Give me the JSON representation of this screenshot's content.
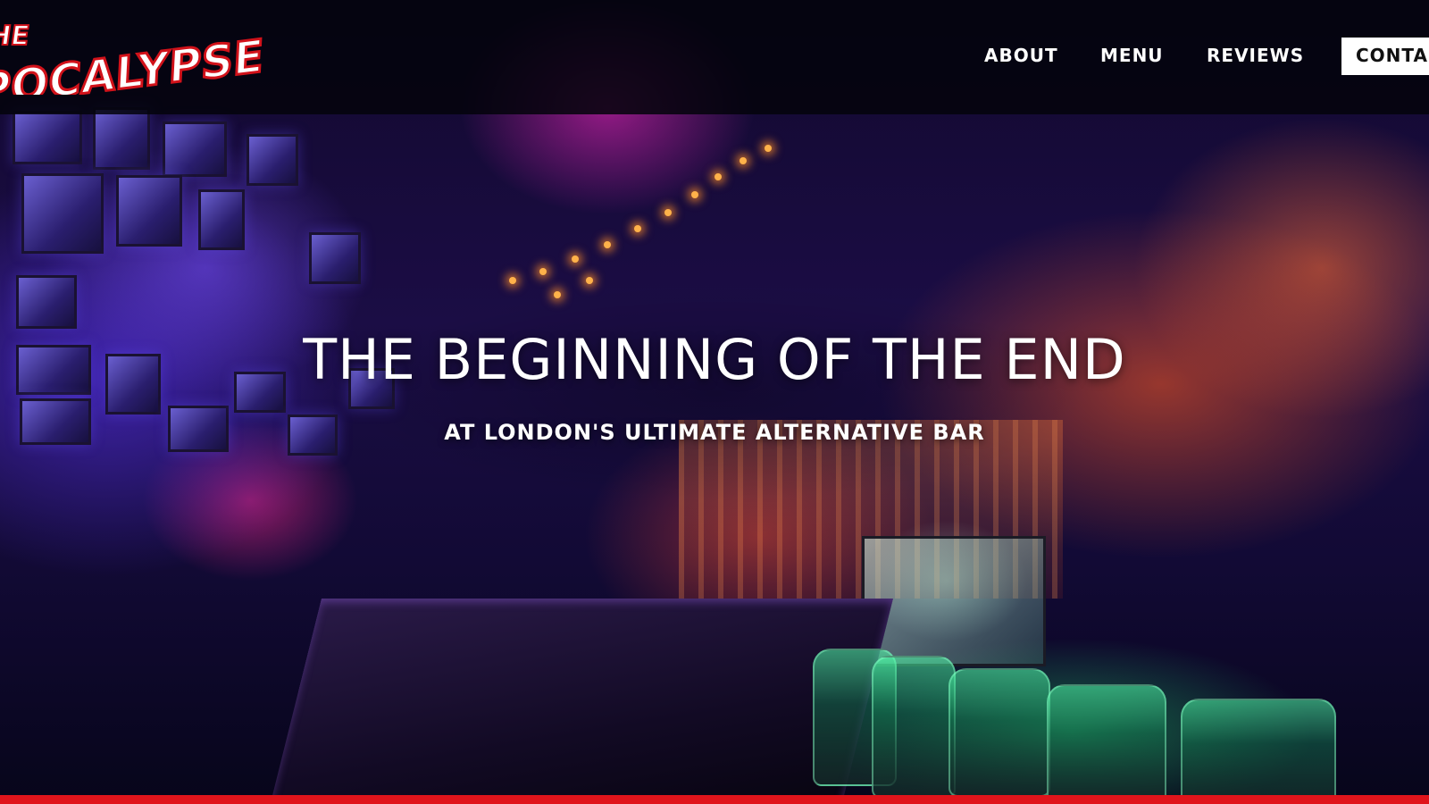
{
  "header": {
    "logo_text": "THE APOCALYPSE",
    "nav": {
      "about": "ABOUT",
      "menu": "MENU",
      "reviews": "REVIEWS",
      "contact": "CONTACT"
    }
  },
  "hero": {
    "title": "THE BEGINNING OF THE END",
    "subtitle": "AT LONDON'S ULTIMATE ALTERNATIVE BAR"
  },
  "colors": {
    "accent": "#e0141b",
    "header_bg": "#04030c",
    "text": "#ffffff"
  }
}
